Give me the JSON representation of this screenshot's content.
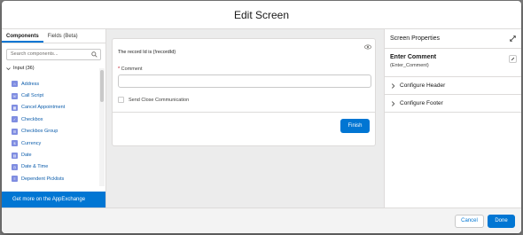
{
  "modal": {
    "title": "Edit Screen"
  },
  "left": {
    "tabs": [
      {
        "label": "Components"
      },
      {
        "label": "Fields (Beta)"
      }
    ],
    "search": {
      "placeholder": "Search components..."
    },
    "section": "Input (36)",
    "items": [
      {
        "label": "Address"
      },
      {
        "label": "Call Script"
      },
      {
        "label": "Cancel Appointment"
      },
      {
        "label": "Checkbox"
      },
      {
        "label": "Checkbox Group"
      },
      {
        "label": "Currency"
      },
      {
        "label": "Date"
      },
      {
        "label": "Date & Time"
      },
      {
        "label": "Dependent Picklists"
      }
    ],
    "appexchange": "Get more on the AppExchange"
  },
  "canvas": {
    "record_text": "The record Id is {!recordId}",
    "comment_label": "Comment",
    "checkbox_label": "Send Close Communication",
    "finish": "Finish"
  },
  "right": {
    "title": "Screen Properties",
    "element_name": "Enter Comment",
    "element_api": "(Enter_Comment)",
    "accordions": [
      {
        "label": "Configure Header"
      },
      {
        "label": "Configure Footer"
      }
    ]
  },
  "footer": {
    "cancel": "Cancel",
    "done": "Done"
  }
}
